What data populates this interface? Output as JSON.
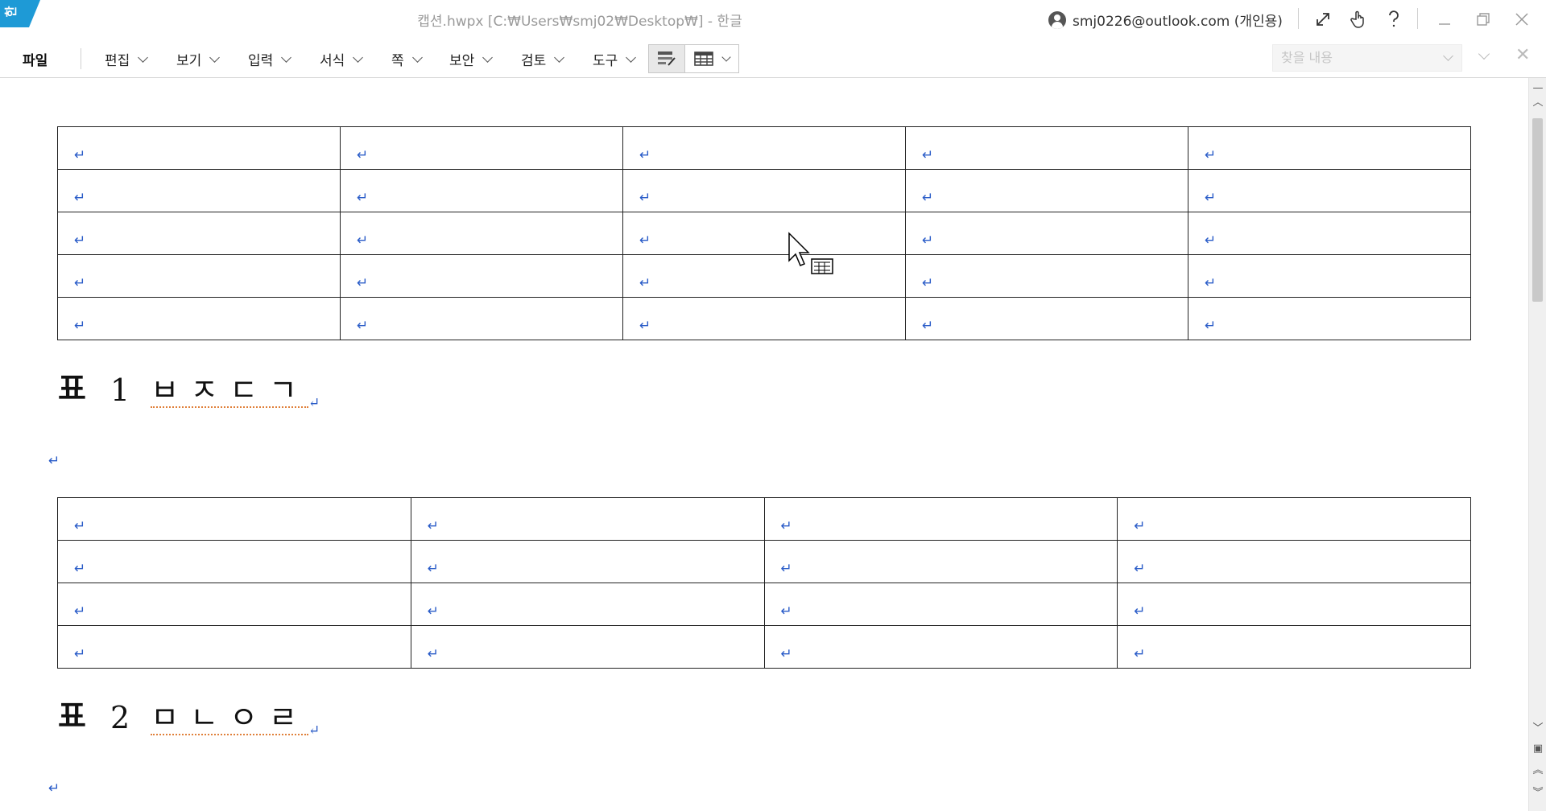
{
  "app": {
    "logo_text": "한",
    "window_title": "캡션.hwpx [C:₩Users₩smj02₩Desktop₩] - 한글",
    "account": "smj0226@outlook.com (개인용)"
  },
  "menu": {
    "file": "파일",
    "items": [
      {
        "label": "편집"
      },
      {
        "label": "보기"
      },
      {
        "label": "입력"
      },
      {
        "label": "서식"
      },
      {
        "label": "쪽"
      },
      {
        "label": "보안"
      },
      {
        "label": "검토"
      },
      {
        "label": "도구"
      }
    ]
  },
  "search": {
    "placeholder": "찾을 내용"
  },
  "paragraph_mark": "↵",
  "table1": {
    "columns": 5,
    "rows": [
      [
        "↵",
        "↵",
        "↵",
        "↵",
        "↵"
      ],
      [
        "↵",
        "↵",
        "↵",
        "↵",
        "↵"
      ],
      [
        "↵",
        "↵",
        "↵",
        "↵",
        "↵"
      ],
      [
        "↵",
        "↵",
        "↵",
        "↵",
        "↵"
      ],
      [
        "↵",
        "↵",
        "↵",
        "↵",
        "↵"
      ]
    ]
  },
  "caption1": {
    "label": "표",
    "number": "1",
    "text": "ㅂㅈㄷㄱ"
  },
  "table2": {
    "columns": 4,
    "rows": [
      [
        "↵",
        "↵",
        "↵",
        "↵"
      ],
      [
        "↵",
        "↵",
        "↵",
        "↵"
      ],
      [
        "↵",
        "↵",
        "↵",
        "↵"
      ],
      [
        "↵",
        "↵",
        "↵",
        "↵"
      ]
    ]
  },
  "caption2": {
    "label": "표",
    "number": "2",
    "text": "ㅁㄴㅇㄹ"
  },
  "icons": {
    "logo": "hancom-logo-icon",
    "user": "user-circle-icon",
    "fullscreen": "expand-icon",
    "touch": "hand-pointer-icon",
    "help": "help-icon",
    "minimize": "minimize-icon",
    "restore": "restore-icon",
    "close": "close-icon"
  },
  "colors": {
    "logo": "#1e9ad6",
    "paragraph_mark": "#2a5cc8",
    "spell_underline": "#e0803a"
  }
}
